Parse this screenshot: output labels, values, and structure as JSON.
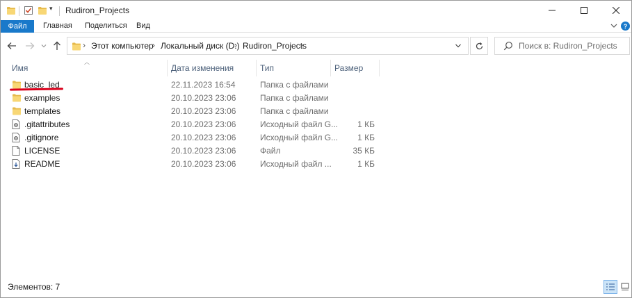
{
  "window": {
    "title": "Rudiron_Projects"
  },
  "ribbon": {
    "tabs": [
      {
        "label": "Файл",
        "active": true
      },
      {
        "label": "Главная"
      },
      {
        "label": "Поделиться"
      },
      {
        "label": "Вид"
      }
    ]
  },
  "address": {
    "crumbs": [
      "Этот компьютер",
      "Локальный диск (D:)",
      "Rudiron_Projects"
    ]
  },
  "search": {
    "placeholder": "Поиск в: Rudiron_Projects"
  },
  "columns": {
    "name": "Имя",
    "date": "Дата изменения",
    "type": "Тип",
    "size": "Размер"
  },
  "files": [
    {
      "name": "basic_led",
      "date": "22.11.2023 16:54",
      "type": "Папка с файлами",
      "size": "",
      "icon": "folder-icon"
    },
    {
      "name": "examples",
      "date": "20.10.2023 23:06",
      "type": "Папка с файлами",
      "size": "",
      "icon": "folder-icon"
    },
    {
      "name": "templates",
      "date": "20.10.2023 23:06",
      "type": "Папка с файлами",
      "size": "",
      "icon": "folder-icon"
    },
    {
      "name": ".gitattributes",
      "date": "20.10.2023 23:06",
      "type": "Исходный файл G...",
      "size": "1 КБ",
      "icon": "gear-file-icon"
    },
    {
      "name": ".gitignore",
      "date": "20.10.2023 23:06",
      "type": "Исходный файл G...",
      "size": "1 КБ",
      "icon": "gear-file-icon"
    },
    {
      "name": "LICENSE",
      "date": "20.10.2023 23:06",
      "type": "Файл",
      "size": "35 КБ",
      "icon": "blank-file-icon"
    },
    {
      "name": "README",
      "date": "20.10.2023 23:06",
      "type": "Исходный файл ...",
      "size": "1 КБ",
      "icon": "markdown-file-icon"
    }
  ],
  "status": {
    "items_text": "Элементов: 7"
  },
  "colors": {
    "accent": "#1979ca",
    "folder": "#f8d775",
    "annotation": "#d9001b"
  }
}
